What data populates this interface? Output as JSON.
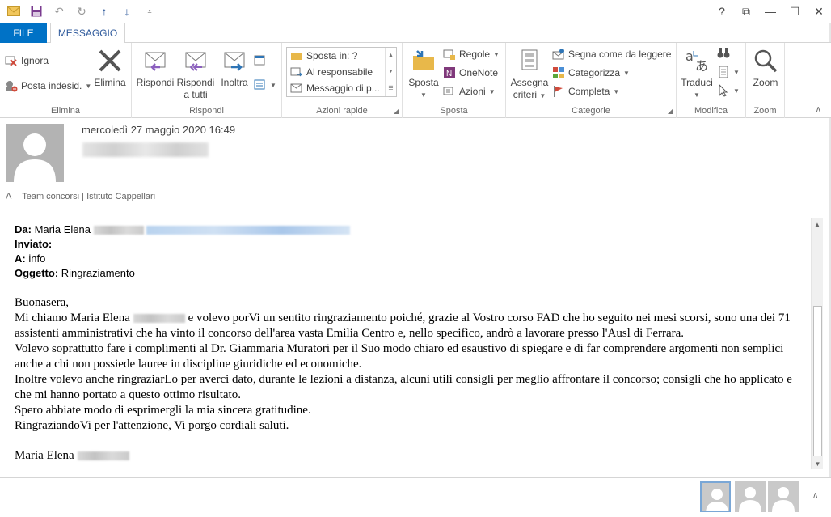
{
  "qat": {
    "icons": [
      "mail-icon",
      "save-icon",
      "undo-icon",
      "redo-icon",
      "up-arrow-icon",
      "down-arrow-icon",
      "customize-icon"
    ]
  },
  "window": {
    "help": "?",
    "restore": "⧉",
    "minimize": "—",
    "maximize": "☐",
    "close": "✕"
  },
  "tabs": {
    "file": "FILE",
    "message": "MESSAGGIO"
  },
  "ribbon": {
    "elimina": {
      "ignora": "Ignora",
      "posta_indesid": "Posta indesid.",
      "elimina": "Elimina",
      "label": "Elimina"
    },
    "rispondi": {
      "rispondi": "Rispondi",
      "rispondi_a": "Rispondi",
      "a_tutti": "a tutti",
      "inoltra": "Inoltra",
      "label": "Rispondi"
    },
    "azioni_rapide": {
      "items": [
        "Sposta in: ?",
        "Al responsabile",
        "Messaggio di p..."
      ],
      "label": "Azioni rapide"
    },
    "sposta": {
      "sposta": "Sposta",
      "regole": "Regole",
      "onenote": "OneNote",
      "azioni": "Azioni",
      "label": "Sposta"
    },
    "categorie": {
      "assegna": "Assegna",
      "criteri": "criteri",
      "segna": "Segna come da leggere",
      "categorizza": "Categorizza",
      "completa": "Completa",
      "label": "Categorie"
    },
    "modifica": {
      "traduci": "Traduci",
      "label": "Modifica"
    },
    "zoom": {
      "zoom": "Zoom",
      "label": "Zoom"
    }
  },
  "header": {
    "date": "mercoledì 27 maggio 2020 16:49",
    "to_label": "A",
    "to_value": "Team concorsi | Istituto Cappellari"
  },
  "mail": {
    "da_label": "Da:",
    "da_value": "Maria Elena",
    "inviato_label": "Inviato:",
    "a_label": "A:",
    "a_value": "info",
    "oggetto_label": "Oggetto:",
    "oggetto_value": "Ringraziamento",
    "greeting": "Buonasera,",
    "p1_a": "Mi chiamo Maria Elena",
    "p1_b": " e volevo porVi un sentito ringraziamento poiché, grazie al Vostro corso FAD che ho seguito nei mesi scorsi, sono una dei 71 assistenti amministrativi che ha vinto il concorso dell'area vasta Emilia Centro e, nello specifico, andrò a lavorare presso l'Ausl di Ferrara.",
    "p2": "Volevo soprattutto fare i complimenti al Dr. Giammaria Muratori per il Suo modo chiaro ed esaustivo di spiegare e di far comprendere argomenti non semplici anche a chi non possiede lauree in discipline giuridiche ed economiche.",
    "p3": "Inoltre volevo anche ringraziarLo per averci dato, durante le lezioni a distanza, alcuni utili consigli per meglio affrontare il concorso; consigli che ho applicato e che mi hanno portato a questo ottimo risultato.",
    "p4": "Spero abbiate modo di esprimergli la mia sincera gratitudine.",
    "p5": "RingraziandoVi per l'attenzione, Vi porgo cordiali saluti.",
    "signature": "Maria Elena"
  },
  "colors": {
    "file_tab": "#0072c6",
    "accent": "#2b579a",
    "avatar": "#b3b3b3"
  }
}
